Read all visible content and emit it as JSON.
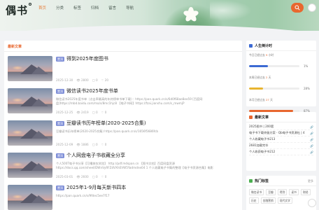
{
  "header": {
    "logo": "偶书",
    "nav": [
      "首页",
      "分类",
      "标签",
      "归档",
      "留言",
      "导航"
    ],
    "active_index": 0,
    "accent": "#e8672f"
  },
  "main": {
    "section_title": "最新文章",
    "posts": [
      {
        "tag": "置顶",
        "title": "得到2025年度图书",
        "desc": "",
        "date": "2025-12-30",
        "views": "2800",
        "comments": "0",
        "likes": "20"
      },
      {
        "tag": "置顶",
        "title": "微信读书2025年度书单",
        "desc": "微信读书2025年度书单（点击率最高的年终榜单书单下载）：https://pan.quark.cn/s/6d0f68ae8ee59 [百度网盘]https://mbd.baidu.com/ma/s/8mc1hjc8 【电子书网】https://fzai.jianshu.com/s_mwmjP",
        "date": "2025-12-25",
        "views": "2419",
        "comments": "0",
        "likes": "0"
      },
      {
        "tag": "置顶",
        "title": "豆瓣读书历年榜单(2020-2025合集)",
        "desc": "豆瓣读书历年榜单(2020-2025合集) https://pan.quark.cn/s/1656f5686fcb",
        "date": "2025-12-09",
        "views": "1886",
        "comments": "0",
        "likes": "0"
      },
      {
        "tag": "置顶",
        "title": "个人网盘电子书收藏全分享",
        "desc": "个人500T电子书分享【可播放仅浏览】 http://pdf.mdspan.cn 【图书文档】百度网盘资源 https://docs.qq.com/sheet/DWnVyRFZdVXhEVW5Yadmdne04 1 个人收藏电子书集的整理【电子书资源合集】电影",
        "date": "2025-03-01",
        "views": "2600",
        "comments": "0",
        "likes": "0"
      },
      {
        "tag": "置顶",
        "title": "2025年1-9月每天新书四本",
        "desc": "https://pan.quark.cn/s/9fdec5ee7f17",
        "date": "",
        "views": "",
        "comments": "",
        "likes": ""
      }
    ]
  },
  "sidebar": {
    "timeline": {
      "title": "人生倒计时",
      "rows": [
        {
          "label": "今日已经过去",
          "value": "9",
          "unit": "小时",
          "percent": "1%",
          "fill": 0.37,
          "color": "#3c6ad3"
        },
        {
          "label": "本周已经过去",
          "value": "2",
          "unit": "天",
          "percent": "28%",
          "fill": 0.28,
          "color": "#e8b42f"
        },
        {
          "label": "本月已经过去",
          "value": "27",
          "unit": "天",
          "percent": "87%",
          "fill": 0.87,
          "color": "#e8672f"
        },
        {
          "label": "今年已经过去",
          "value": "1",
          "unit": "个月",
          "percent": "8%",
          "fill": 0.08,
          "color": "#4caf50"
        }
      ]
    },
    "recent": {
      "title": "最新文章",
      "items": [
        "2025图书 | 200套",
        "电子书下载终极方案 - Qb电子书资源社 | 4",
        "个人收藏电子书213",
        "2681加载完毕",
        "个人收获电子书212"
      ]
    },
    "hot_tags": {
      "title": "热门标签",
      "more": "更多",
      "tags": [
        "微信读书",
        "豆瓣",
        "得到",
        "读书",
        "财经",
        "历史",
        "金融营销",
        "现代文学",
        "评论",
        "书单",
        "小说",
        "外国文学"
      ]
    }
  }
}
